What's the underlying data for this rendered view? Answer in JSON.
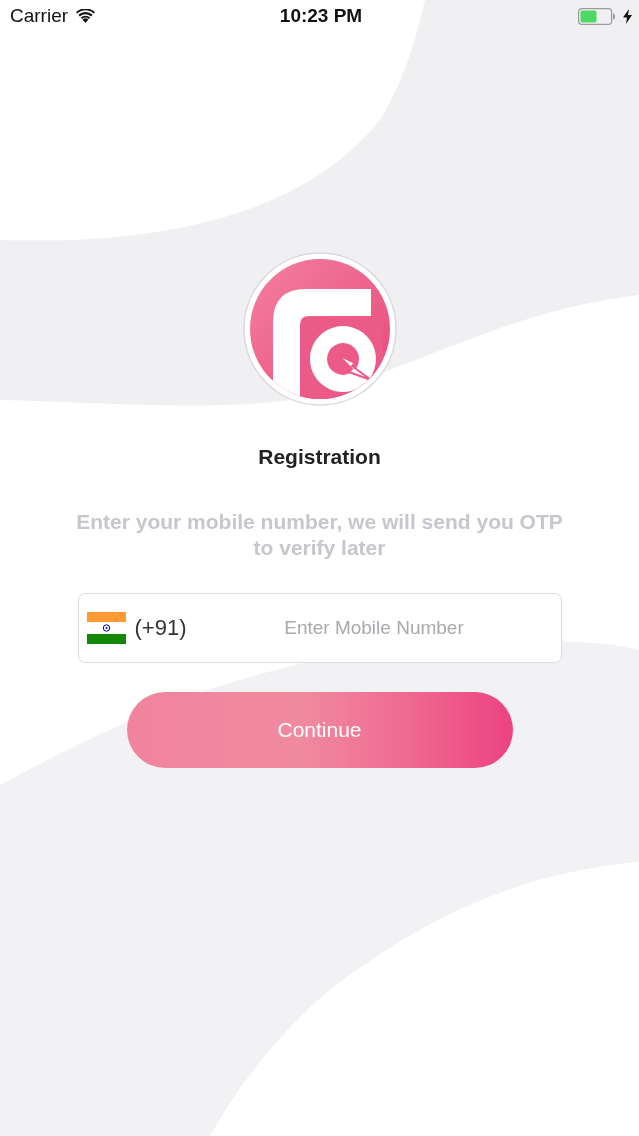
{
  "status_bar": {
    "carrier": "Carrier",
    "time": "10:23 PM"
  },
  "registration": {
    "title": "Registration",
    "subtitle": "Enter your mobile number, we will send you OTP to verify later"
  },
  "phone_field": {
    "country_code": "(+91)",
    "placeholder": "Enter Mobile Number"
  },
  "continue_button": {
    "label": "Continue"
  }
}
